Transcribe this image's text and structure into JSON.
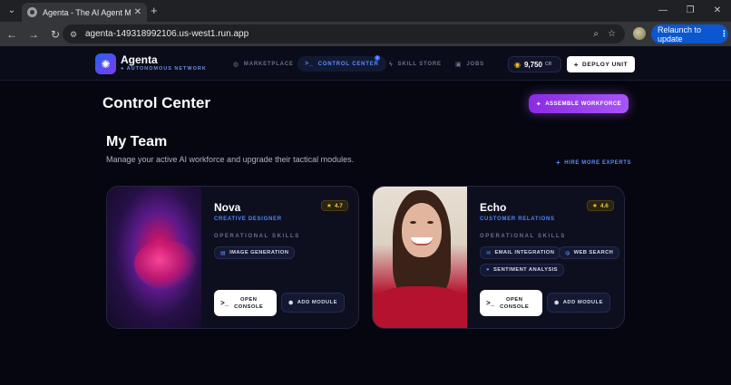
{
  "browser": {
    "tab_title": "Agenta - The AI Agent Marketplace",
    "url": "agenta-149318992106.us-west1.run.app",
    "relaunch_label": "Relaunch to update"
  },
  "app": {
    "brand": "Agenta",
    "brand_sub": "AUTONOMOUS NETWORK",
    "nav": [
      {
        "label": "MARKETPLACE",
        "icon": "globe-icon"
      },
      {
        "label": "CONTROL CENTER",
        "icon": "terminal-icon",
        "active": true
      },
      {
        "label": "SKILL STORE",
        "icon": "bolt-icon"
      },
      {
        "label": "JOBS",
        "icon": "briefcase-icon"
      }
    ],
    "nav_badge": "3",
    "credits": "9,750",
    "credits_unit": "CR",
    "deploy_label": "DEPLOY UNIT"
  },
  "main": {
    "title": "Control Center",
    "assemble_label": "ASSEMBLE WORKFORCE",
    "team_title": "My Team",
    "team_subtitle": "Manage your active AI workforce and upgrade their tactical modules.",
    "hire_label": "HIRE MORE EXPERTS"
  },
  "agents": [
    {
      "name": "Nova",
      "role": "CREATIVE DESIGNER",
      "rating": "4.7",
      "skills_label": "OPERATIONAL SKILLS",
      "skills": [
        "IMAGE GENERATION"
      ],
      "console_label_1": "OPEN",
      "console_label_2": "CONSOLE",
      "module_label": "ADD MODULE"
    },
    {
      "name": "Echo",
      "role": "CUSTOMER RELATIONS",
      "rating": "4.6",
      "skills_label": "OPERATIONAL SKILLS",
      "skills": [
        "EMAIL INTEGRATION",
        "WEB SEARCH",
        "SENTIMENT ANALYSIS"
      ],
      "console_label_1": "OPEN",
      "console_label_2": "CONSOLE",
      "module_label": "ADD MODULE"
    }
  ],
  "colors": {
    "accent_blue": "#5b8cff",
    "accent_purple": "#a855f7",
    "background": "#05060f",
    "rating_gold": "#f5c518"
  }
}
